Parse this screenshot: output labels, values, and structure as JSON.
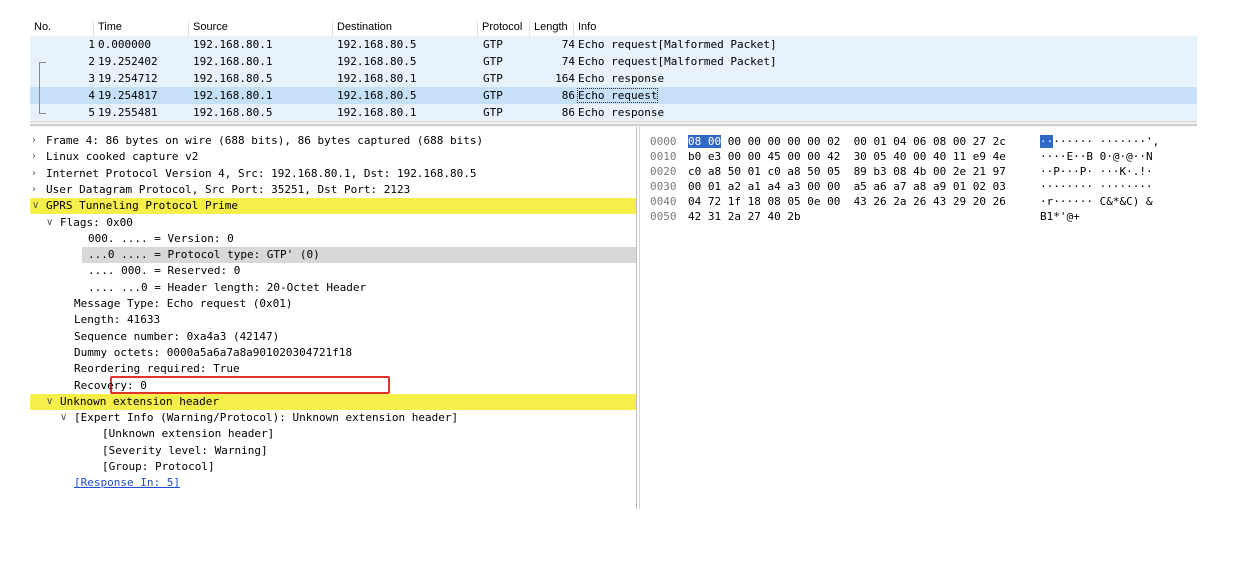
{
  "packet_list": {
    "headers": [
      "No.",
      "Time",
      "Source",
      "Destination",
      "Protocol",
      "Length",
      "Info"
    ],
    "rows": [
      {
        "no": "1",
        "time": "0.000000",
        "src": "192.168.80.1",
        "dst": "192.168.80.5",
        "proto": "GTP",
        "len": "74",
        "info": "Echo request[Malformed Packet]"
      },
      {
        "no": "2",
        "time": "19.252402",
        "src": "192.168.80.1",
        "dst": "192.168.80.5",
        "proto": "GTP",
        "len": "74",
        "info": "Echo request[Malformed Packet]"
      },
      {
        "no": "3",
        "time": "19.254712",
        "src": "192.168.80.5",
        "dst": "192.168.80.1",
        "proto": "GTP",
        "len": "164",
        "info": "Echo response"
      },
      {
        "no": "4",
        "time": "19.254817",
        "src": "192.168.80.1",
        "dst": "192.168.80.5",
        "proto": "GTP",
        "len": "86",
        "info": "Echo request"
      },
      {
        "no": "5",
        "time": "19.255481",
        "src": "192.168.80.5",
        "dst": "192.168.80.1",
        "proto": "GTP",
        "len": "86",
        "info": "Echo response"
      }
    ],
    "selected_row": "4"
  },
  "details": [
    {
      "arrow": ">",
      "indent": 0,
      "text": "Frame 4: 86 bytes on wire (688 bits), 86 bytes captured (688 bits)",
      "style": ""
    },
    {
      "arrow": ">",
      "indent": 0,
      "text": "Linux cooked capture v2",
      "style": ""
    },
    {
      "arrow": ">",
      "indent": 0,
      "text": "Internet Protocol Version 4, Src: 192.168.80.1, Dst: 192.168.80.5",
      "style": ""
    },
    {
      "arrow": ">",
      "indent": 0,
      "text": "User Datagram Protocol, Src Port: 35251, Dst Port: 2123",
      "style": ""
    },
    {
      "arrow": "v",
      "indent": 0,
      "text": "GPRS Tunneling Protocol Prime",
      "style": "hl"
    },
    {
      "arrow": "v",
      "indent": 1,
      "text": "Flags: 0x00",
      "style": ""
    },
    {
      "arrow": "",
      "indent": 3,
      "text": "000. .... = Version: 0",
      "style": ""
    },
    {
      "arrow": "",
      "indent": 3,
      "text": "...0 .... = Protocol type: GTP' (0)",
      "style": "grey"
    },
    {
      "arrow": "",
      "indent": 3,
      "text": ".... 000. = Reserved: 0",
      "style": ""
    },
    {
      "arrow": "",
      "indent": 3,
      "text": ".... ...0 = Header length: 20-Octet Header",
      "style": ""
    },
    {
      "arrow": "",
      "indent": 2,
      "text": "Message Type: Echo request (0x01)",
      "style": ""
    },
    {
      "arrow": "",
      "indent": 2,
      "text": "Length: 41633",
      "style": ""
    },
    {
      "arrow": "",
      "indent": 2,
      "text": "Sequence number: 0xa4a3 (42147)",
      "style": ""
    },
    {
      "arrow": "",
      "indent": 2,
      "text": "Dummy octets: 0000a5a6a7a8a901020304721f18",
      "style": ""
    },
    {
      "arrow": "",
      "indent": 2,
      "text": "Reordering required: True",
      "style": ""
    },
    {
      "arrow": "",
      "indent": 2,
      "text": "Recovery: 0",
      "style": ""
    },
    {
      "arrow": "v",
      "indent": 1,
      "text": "Unknown extension header",
      "style": "hl"
    },
    {
      "arrow": "v",
      "indent": 2,
      "text": "[Expert Info (Warning/Protocol): Unknown extension header]",
      "style": ""
    },
    {
      "arrow": "",
      "indent": 4,
      "text": "[Unknown extension header]",
      "style": ""
    },
    {
      "arrow": "",
      "indent": 4,
      "text": "[Severity level: Warning]",
      "style": ""
    },
    {
      "arrow": "",
      "indent": 4,
      "text": "[Group: Protocol]",
      "style": ""
    },
    {
      "arrow": "",
      "indent": 2,
      "text": "[Response In: 5]",
      "style": "link"
    }
  ],
  "bytes": [
    {
      "off": "0000",
      "hex_sel": "08 00",
      "hex": " 00 00 00 00 00 02  00 01 04 06 08 00 27 2c",
      "asc_sel": "··",
      "asc": "······ ·······',"
    },
    {
      "off": "0010",
      "hex_sel": "",
      "hex": "b0 e3 00 00 45 00 00 42  30 05 40 00 40 11 e9 4e",
      "asc_sel": "",
      "asc": "····E··B 0·@·@··N"
    },
    {
      "off": "0020",
      "hex_sel": "",
      "hex": "c0 a8 50 01 c0 a8 50 05  89 b3 08 4b 00 2e 21 97",
      "asc_sel": "",
      "asc": "··P···P· ···K·.!·"
    },
    {
      "off": "0030",
      "hex_sel": "",
      "hex": "00 01 a2 a1 a4 a3 00 00  a5 a6 a7 a8 a9 01 02 03",
      "asc_sel": "",
      "asc": "········ ········"
    },
    {
      "off": "0040",
      "hex_sel": "",
      "hex": "04 72 1f 18 08 05 0e 00  43 26 2a 26 43 29 20 26",
      "asc_sel": "",
      "asc": "·r······ C&*&C) &"
    },
    {
      "off": "0050",
      "hex_sel": "",
      "hex": "42 31 2a 27 40 2b",
      "asc_sel": "",
      "asc": "B1*'@+"
    }
  ]
}
